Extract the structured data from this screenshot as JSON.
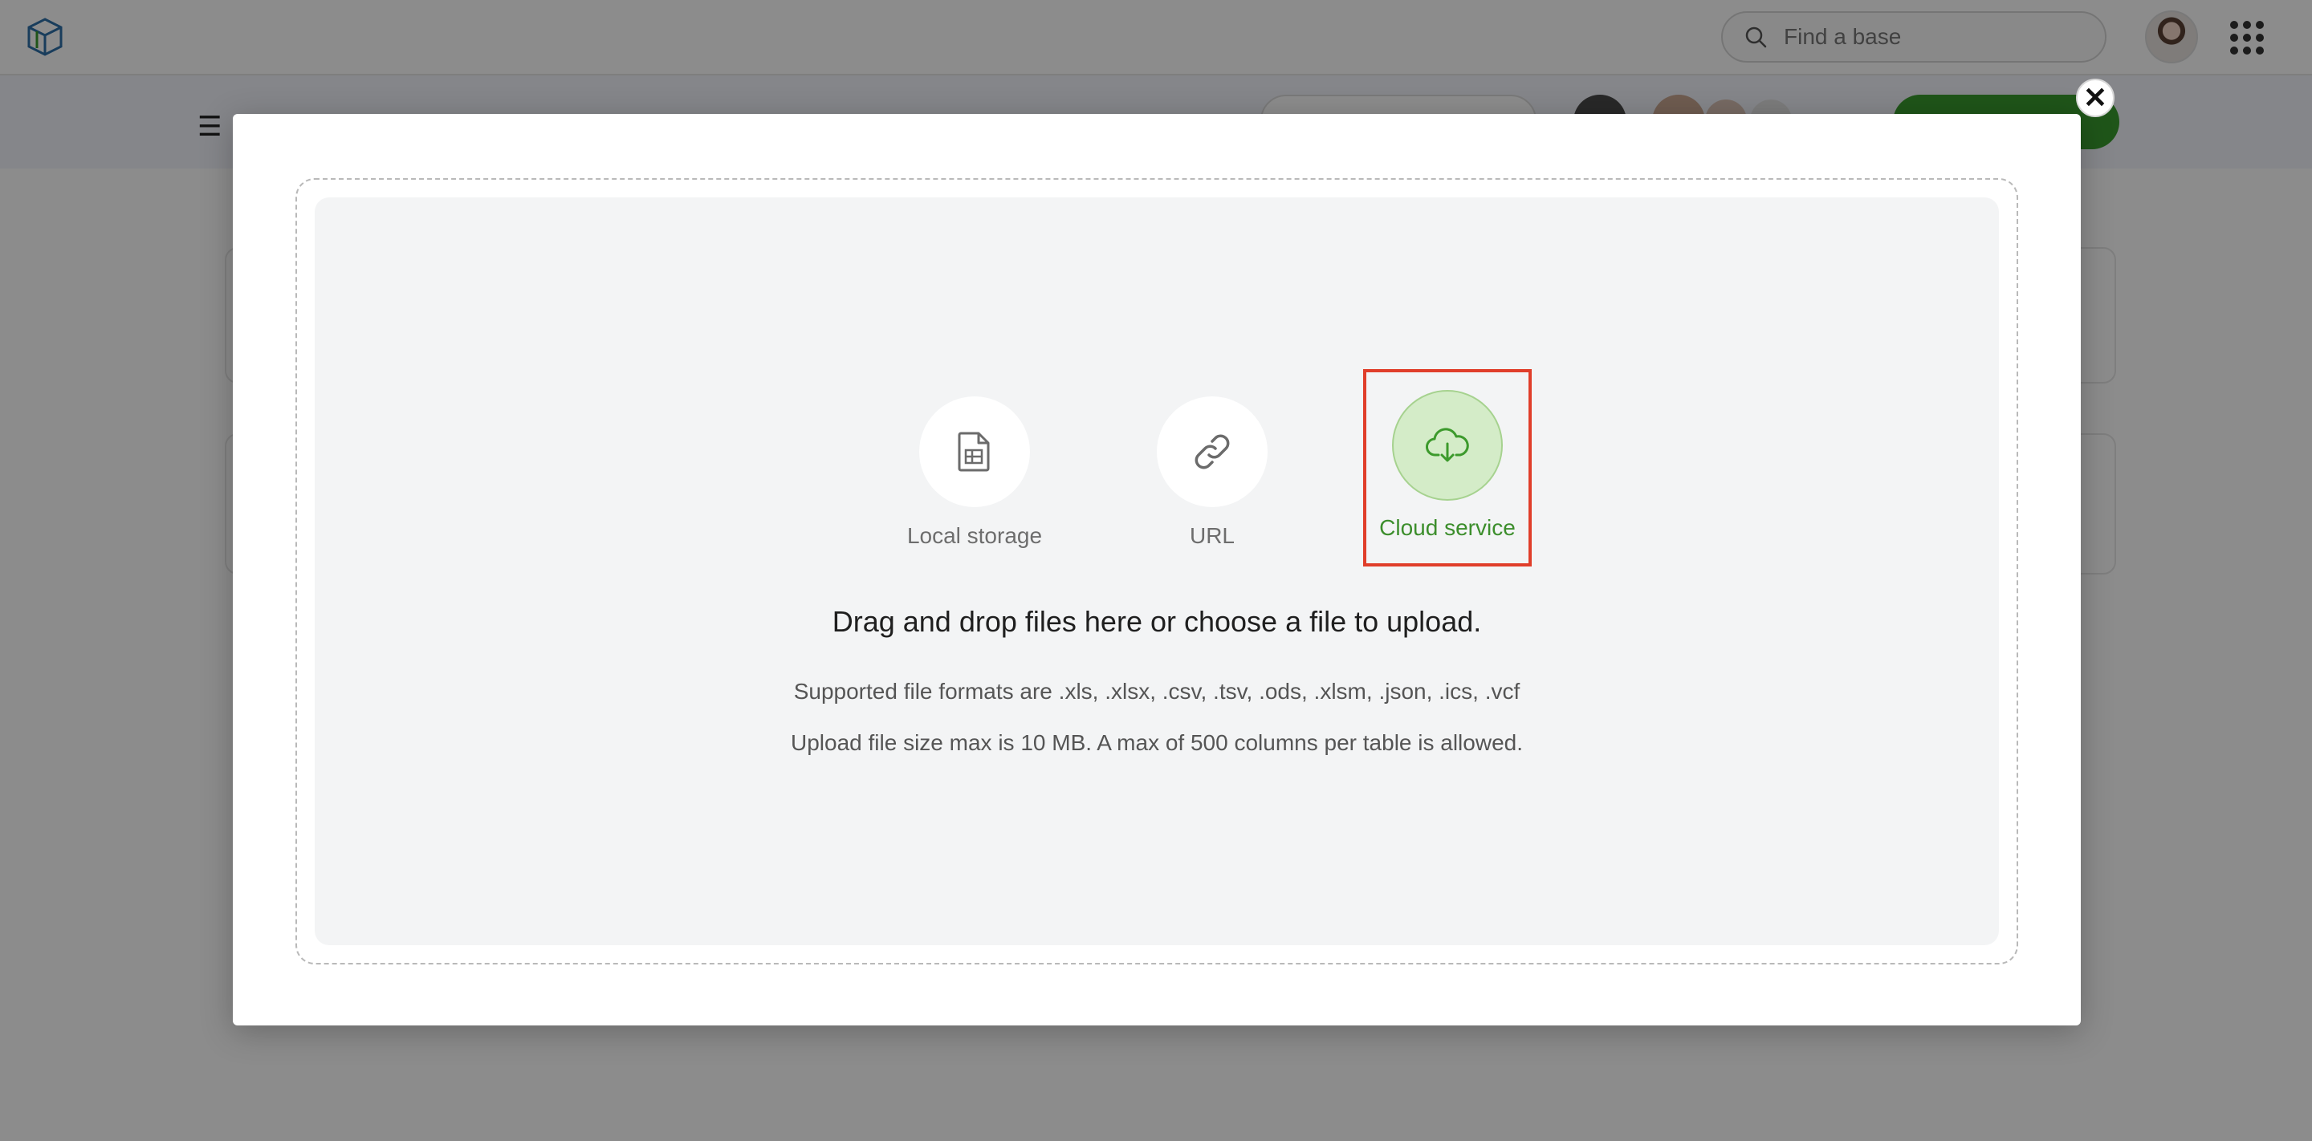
{
  "header": {
    "search_placeholder": "Find a base"
  },
  "modal": {
    "close_symbol": "✕",
    "sources": [
      {
        "label": "Local storage",
        "icon": "spreadsheet-file-icon"
      },
      {
        "label": "URL",
        "icon": "link-icon"
      },
      {
        "label": "Cloud service",
        "icon": "cloud-download-icon",
        "selected": true
      }
    ],
    "heading": "Drag and drop files here or choose a file to upload.",
    "formats": "Supported file formats are .xls, .xlsx, .csv, .tsv, .ods, .xlsm, .json, .ics, .vcf",
    "limits": "Upload file size max is 10 MB. A max of 500 columns per table is allowed."
  },
  "colors": {
    "accent_green": "#3c8e2c",
    "highlight_red": "#e03e2a",
    "dropzone_bg": "#f3f4f5"
  }
}
